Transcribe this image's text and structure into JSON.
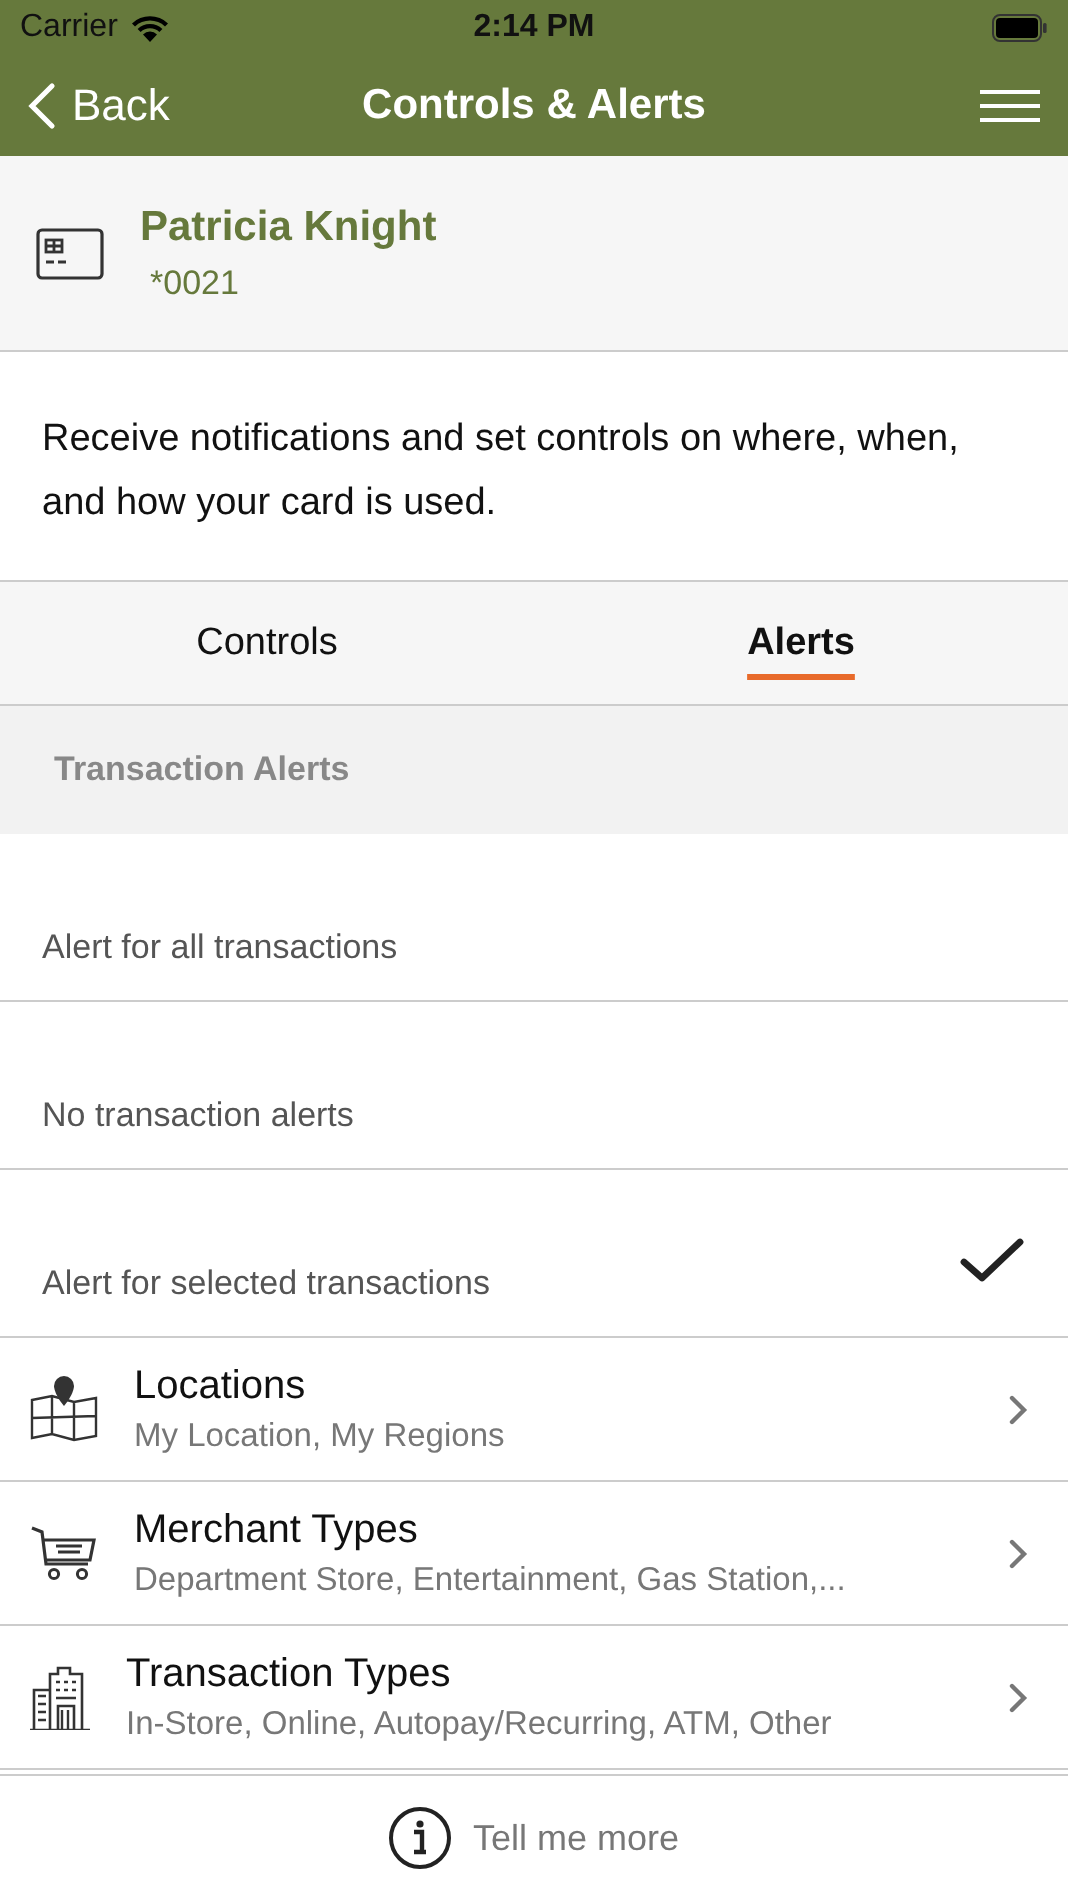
{
  "status_bar": {
    "carrier": "Carrier",
    "time": "2:14 PM"
  },
  "nav": {
    "back": "Back",
    "title": "Controls & Alerts"
  },
  "card": {
    "name": "Patricia Knight",
    "number": "*0021"
  },
  "description": "Receive notifications and set controls on where, when, and how your card is used.",
  "tabs": [
    {
      "label": "Controls",
      "selected": false
    },
    {
      "label": "Alerts",
      "selected": true
    }
  ],
  "section_header": "Transaction Alerts",
  "options": [
    {
      "label": "Alert for all transactions",
      "selected": false
    },
    {
      "label": "No transaction alerts",
      "selected": false
    },
    {
      "label": "Alert for selected transactions",
      "selected": true
    }
  ],
  "categories": [
    {
      "kind": "map",
      "title": "Locations",
      "subtitle": "My Location, My Regions"
    },
    {
      "kind": "cart",
      "title": "Merchant Types",
      "subtitle": "Department Store, Entertainment, Gas Station,..."
    },
    {
      "kind": "buildings",
      "title": "Transaction Types",
      "subtitle": "In-Store, Online, Autopay/Recurring, ATM, Other"
    }
  ],
  "footer": {
    "link": "Tell me more"
  }
}
